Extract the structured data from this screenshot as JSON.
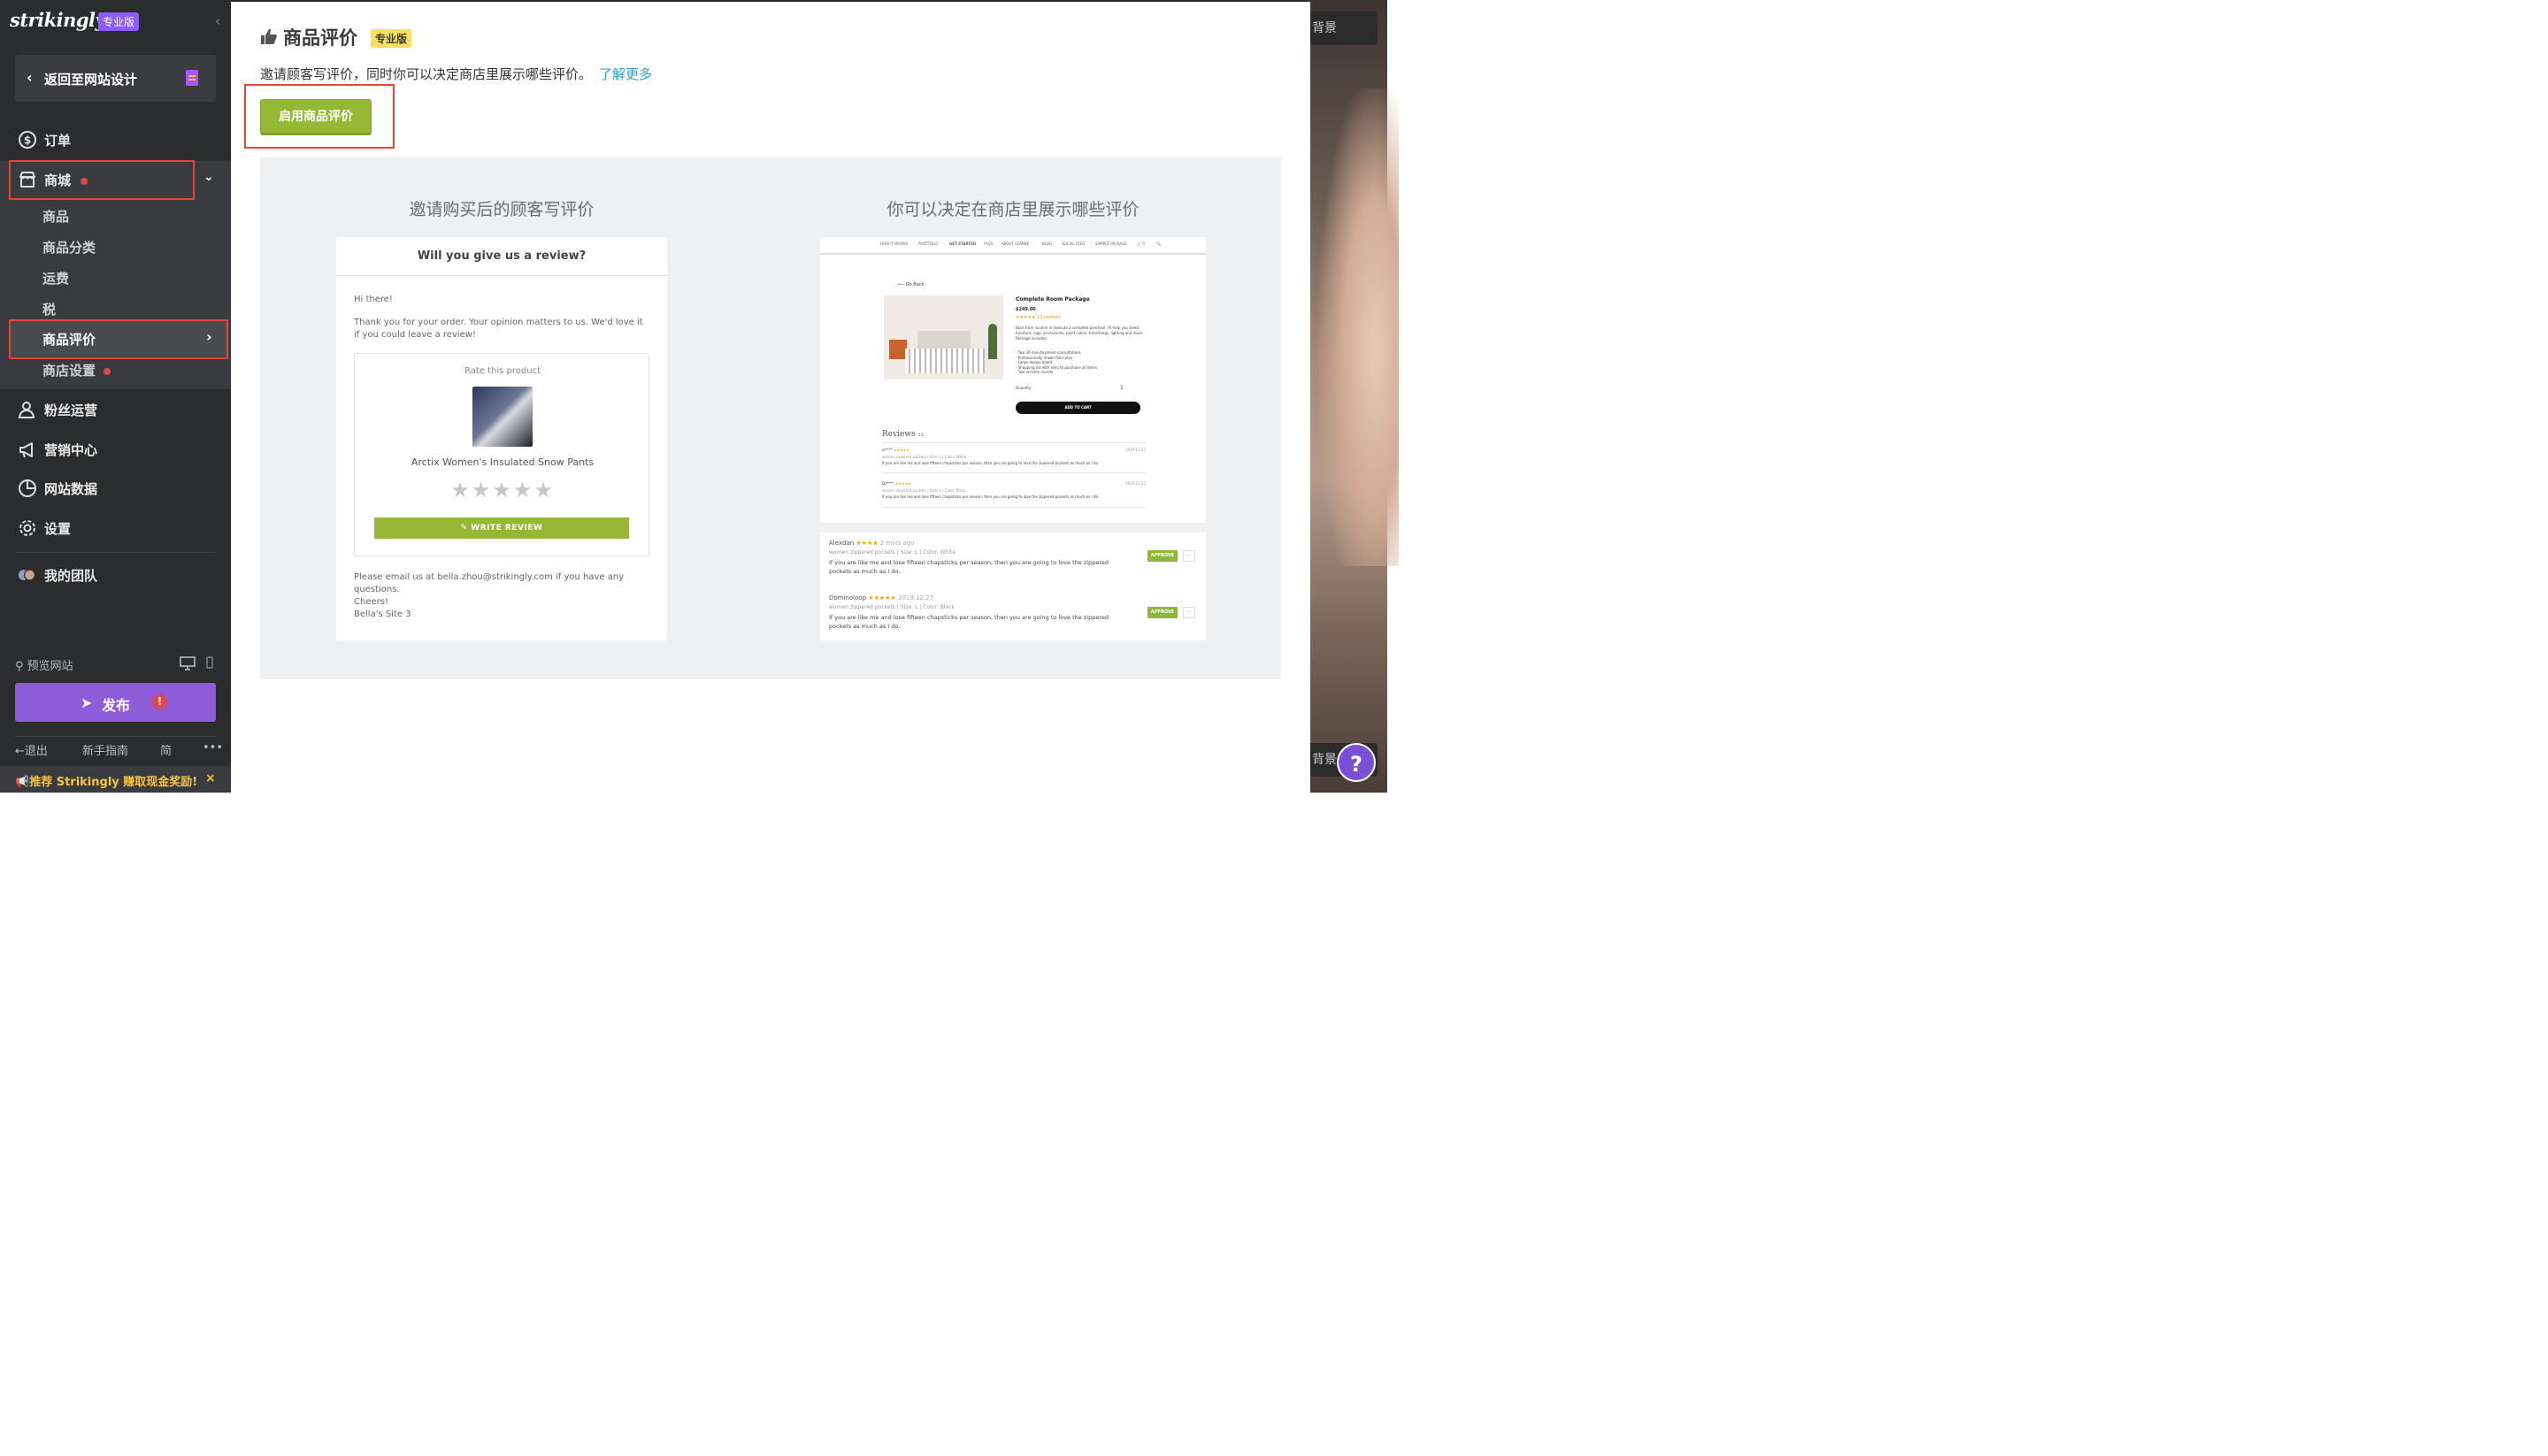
{
  "sidebar": {
    "logo": "strikingly",
    "logo_badge": "专业版",
    "back_label": "返回至网站设计",
    "nav": {
      "orders": "订单",
      "store": "商城",
      "fans": "粉丝运营",
      "marketing": "营销中心",
      "analytics": "网站数据",
      "settings": "设置",
      "team": "我的团队"
    },
    "store_sub": [
      "商品",
      "商品分类",
      "运费",
      "税",
      "商品评价",
      "商店设置"
    ],
    "preview_label": "预览网站",
    "publish_label": "发布",
    "publish_warn": "!",
    "logout": "退出",
    "guide": "新手指南",
    "lang": "简",
    "more": "•••",
    "referral": "推荐 Strikingly 赚取现金奖励!",
    "referral_close": "×"
  },
  "main": {
    "title": "商品评价",
    "pro_badge": "专业版",
    "description": "邀请顾客写评价，同时你可以决定商店里展示哪些评价。",
    "learn_more": "了解更多",
    "enable_button": "启用商品评价",
    "left_heading": "邀请购买后的顾客写评价",
    "right_heading": "你可以决定在商店里展示哪些评价",
    "email": {
      "header": "Will you give us a review?",
      "greeting": "Hi there!",
      "body": "Thank you for your order. Your opinion matters to us. We'd love it if you could leave a review!",
      "rate_title": "Rate this product",
      "product_name": "Arctix Women's Insulated Snow Pants",
      "stars": "★★★★★",
      "write_review": "WRITE REVIEW",
      "contact": "Please email us at bella.zhou@strikingly.com if you have any questions.",
      "signoff": "Cheers!",
      "signature": "Bella's Site 3"
    },
    "shop": {
      "nav": [
        "HOW IT WORKS",
        "PORTFOLIO",
        "GET STARTED",
        "FAQS",
        "ABOUT LEANNE",
        "BLOG",
        "SOCIAL FEED",
        "SAMPLE PACKAGE",
        "🛒 0",
        "🔍"
      ],
      "go_back": "⟵ Go Back",
      "product_title": "Complete Room Package",
      "price": "$249.00",
      "rating": "★★★★★  13 reviews",
      "desc": "Start from scratch or execute a complete overhaul. I'll help you select furniture, rugs, accessories, paint colors, furnishings, lighting and more. Package includes:",
      "bullets": "- Two 30 minute phone consultations\n- Professionally drawn floor plan\n- Large design board\n- Shopping list with links to purchase all items\n- Two revision rounds",
      "quantity_label": "Quantity",
      "quantity": "1",
      "add_to_cart": "ADD TO CART",
      "reviews_heading": "Reviews",
      "reviews_count": "15",
      "review_items": [
        {
          "author": "al****",
          "stars": "★★★★★",
          "date": "2019.12.27",
          "meta": "women zippered pockets  |  Size: L  |  Color: White",
          "text": "If you are like me and lose fifteen chapsticks per season, then you are going to love the zippered pockets as much as I do."
        },
        {
          "author": "Do****",
          "stars": "★★★★★",
          "date": "2019.12.27",
          "meta": "women zippered pockets  |  Size: L  |  Color: Black",
          "text": "If you are like me and lose fifteen chapsticks per season, then you are going to love the zippered pockets as much as I do."
        }
      ]
    },
    "admin": {
      "reviews": [
        {
          "author": "Alexdan",
          "stars": "★★★★",
          "date": "2 mins ago",
          "meta": "women zippered pockets  |  Size: L  |  Color: White",
          "text": "If you are like me and lose fifteen chapsticks per season, then you are going to love the zippered pockets as much as I do.",
          "action": "APPROVE",
          "more": "···"
        },
        {
          "author": "Dominoloop",
          "stars": "★★★★★",
          "date": "2019.12.27",
          "meta": "women zippered pockets  |  Size: L  |  Color: Black",
          "text": "If you are like me and lose fifteen chapsticks per season, then you are going to love the zippered pockets as much as I do.",
          "action": "APPROVE",
          "more": "···"
        }
      ]
    }
  },
  "right_panel": {
    "bg_button": "背景",
    "help": "?"
  },
  "colors": {
    "sidebar_bg": "#2b2c2e",
    "accent_green": "#96b836",
    "publish_purple": "#8e5bd9",
    "highlight_red": "#e8443a",
    "link_blue": "#2a9fd6"
  }
}
